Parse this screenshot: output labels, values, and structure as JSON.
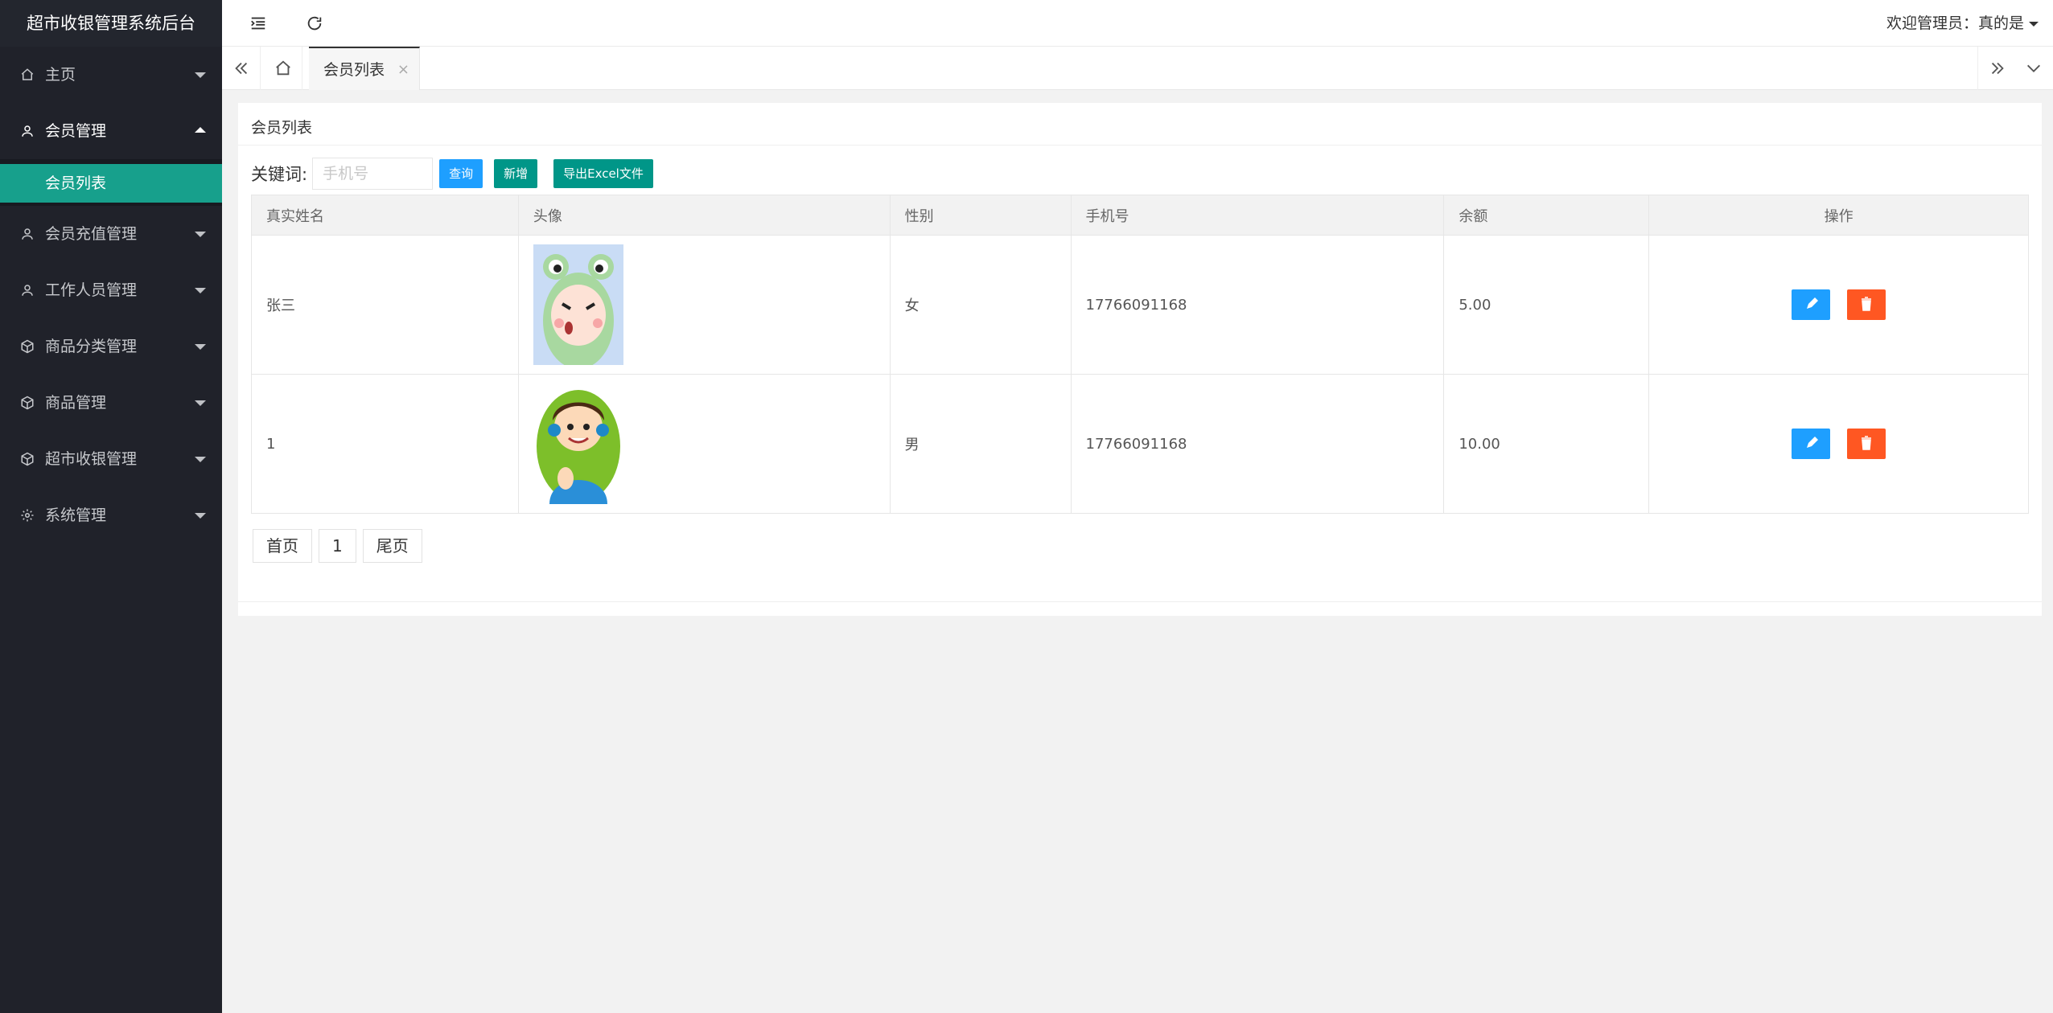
{
  "app": {
    "title": "超市收银管理系统后台"
  },
  "sidebar": {
    "items": [
      {
        "label": "主页",
        "icon": "home-icon"
      },
      {
        "label": "会员管理",
        "icon": "user-icon",
        "open": true,
        "children": [
          {
            "label": "会员列表",
            "active": true
          }
        ]
      },
      {
        "label": "会员充值管理",
        "icon": "user-icon"
      },
      {
        "label": "工作人员管理",
        "icon": "user-icon"
      },
      {
        "label": "商品分类管理",
        "icon": "cube-icon"
      },
      {
        "label": "商品管理",
        "icon": "cube-icon"
      },
      {
        "label": "超市收银管理",
        "icon": "cube-icon"
      },
      {
        "label": "系统管理",
        "icon": "gear-icon"
      }
    ]
  },
  "header": {
    "welcome": "欢迎管理员：真的是"
  },
  "tabs": [
    {
      "label": "会员列表",
      "close": "×"
    }
  ],
  "panel": {
    "title": "会员列表",
    "search": {
      "label": "关键词:",
      "placeholder": "手机号",
      "value": ""
    },
    "buttons": {
      "query": "查询",
      "add": "新增",
      "export": "导出Excel文件"
    }
  },
  "table": {
    "headers": [
      "真实姓名",
      "头像",
      "性别",
      "手机号",
      "余额",
      "操作"
    ],
    "rows": [
      {
        "name": "张三",
        "avatar": "frog-hood-avatar",
        "gender": "女",
        "phone": "17766091168",
        "balance": "5.00"
      },
      {
        "name": "1",
        "avatar": "headphone-boy-avatar",
        "gender": "男",
        "phone": "17766091168",
        "balance": "10.00"
      }
    ]
  },
  "pagination": {
    "first": "首页",
    "current": "1",
    "last": "尾页"
  },
  "colors": {
    "sidebar_bg": "#20222a",
    "active_item": "#17a08c",
    "primary": "#1e9fff",
    "success": "#009688",
    "danger": "#ff5722"
  }
}
